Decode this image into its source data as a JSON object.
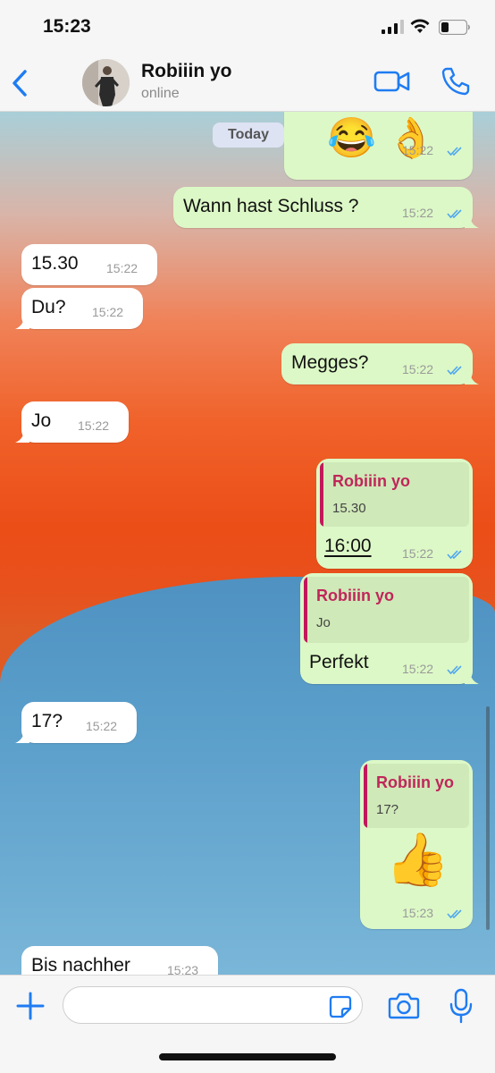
{
  "status_bar": {
    "time": "15:23"
  },
  "header": {
    "contact_name": "Robiiin yo",
    "contact_status": "online",
    "icons": [
      "back-chevron-icon",
      "video-call-icon",
      "phone-icon"
    ]
  },
  "chat": {
    "date_separator": "Today",
    "messages": [
      {
        "dir": "out",
        "text": "😂👌",
        "time": "15:22"
      },
      {
        "dir": "out",
        "text": "Wann hast Schluss ?",
        "time": "15:22"
      },
      {
        "dir": "in",
        "text": "15.30",
        "time": "15:22"
      },
      {
        "dir": "in",
        "text": "Du?",
        "time": "15:22"
      },
      {
        "dir": "out",
        "text": "Megges?",
        "time": "15:22"
      },
      {
        "dir": "in",
        "text": "Jo",
        "time": "15:22"
      },
      {
        "dir": "out",
        "quote_name": "Robiiin yo",
        "quote_text": "15.30",
        "text": "16:00",
        "time": "15:22"
      },
      {
        "dir": "out",
        "quote_name": "Robiiin yo",
        "quote_text": "Jo",
        "text": "Perfekt",
        "time": "15:22"
      },
      {
        "dir": "in",
        "text": "17?",
        "time": "15:22"
      },
      {
        "dir": "out",
        "quote_name": "Robiiin yo",
        "quote_text": "17?",
        "text": "👍",
        "time": "15:23"
      },
      {
        "dir": "in",
        "text": "Bis nachher",
        "time": "15:23"
      }
    ]
  },
  "input_bar": {
    "placeholder": "",
    "icons": [
      "plus-icon",
      "sticker-icon",
      "camera-icon",
      "microphone-icon"
    ]
  },
  "colors": {
    "accent": "#1f7cf2",
    "outgoing_bubble": "#dcf8c6",
    "incoming_bubble": "#ffffff",
    "quote_name": "#c0265a",
    "read_ticks": "#4fa7f0"
  }
}
